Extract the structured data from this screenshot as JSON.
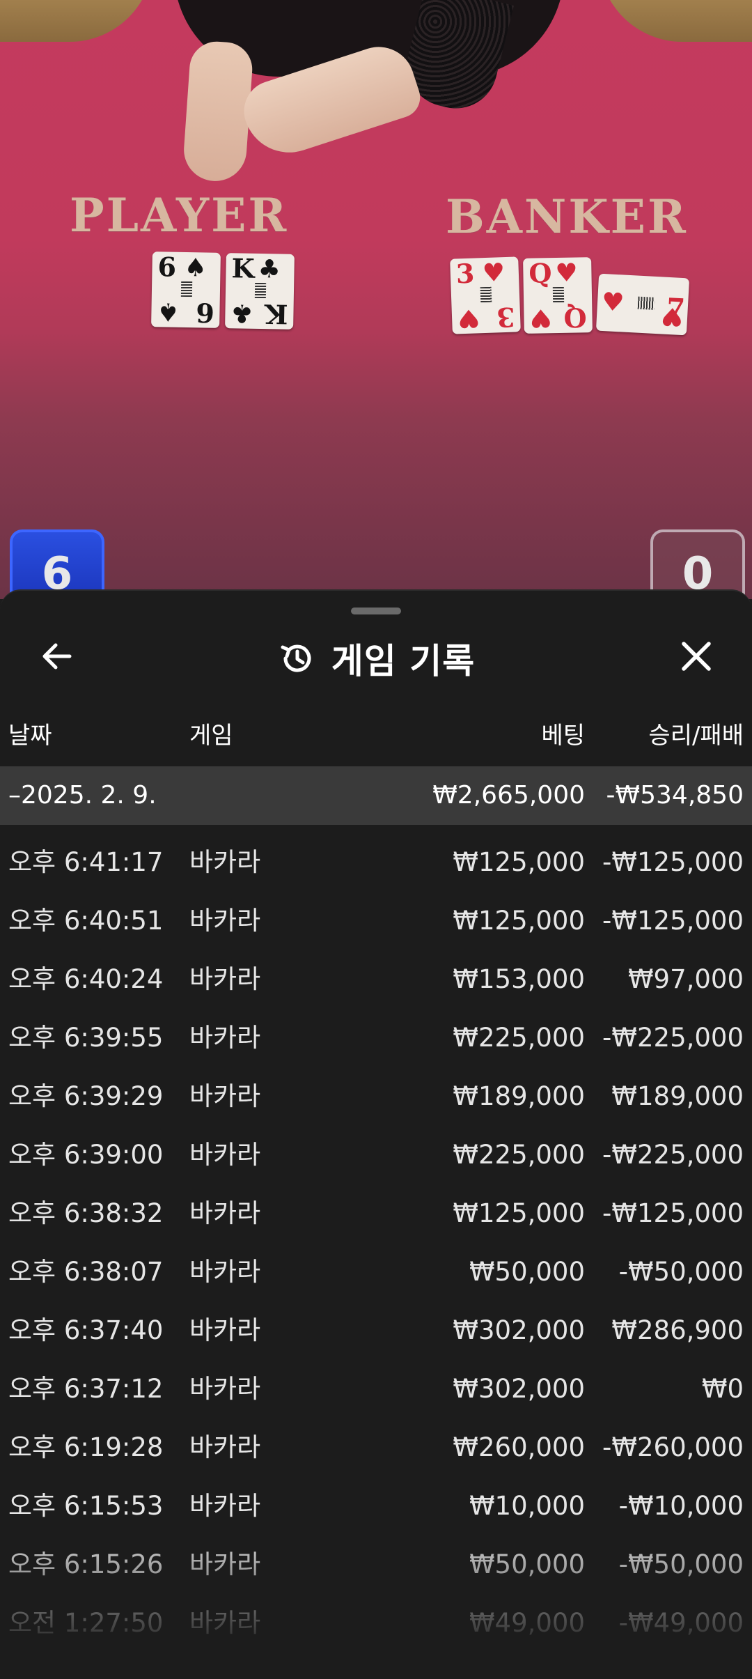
{
  "video": {
    "player_label": "PLAYER",
    "banker_label": "BANKER",
    "player_cards": [
      {
        "rank": "6",
        "suit": "♠",
        "color": "black"
      },
      {
        "rank": "K",
        "suit": "♣",
        "color": "black"
      }
    ],
    "banker_cards": [
      {
        "rank": "3",
        "suit": "♥",
        "color": "red"
      },
      {
        "rank": "Q",
        "suit": "♥",
        "color": "red"
      },
      {
        "rank": "7",
        "suit": "♥",
        "color": "red"
      }
    ],
    "player_score": "6",
    "banker_score": "0",
    "colors": {
      "felt": "#c43a5e",
      "player_badge": "#2a4fe0"
    }
  },
  "sheet": {
    "title": "게임 기록",
    "icons": {
      "back": "arrow-left-icon",
      "history": "history-icon",
      "close": "close-icon"
    },
    "columns": {
      "date": "날짜",
      "game": "게임",
      "bet": "베팅",
      "result": "승리/패배"
    },
    "group": {
      "date": "–2025. 2. 9.",
      "bet": "₩2,665,000",
      "result": "-₩534,850"
    },
    "rows": [
      {
        "time": "오후 6:41:17",
        "game": "바카라",
        "bet": "₩125,000",
        "result": "-₩125,000"
      },
      {
        "time": "오후 6:40:51",
        "game": "바카라",
        "bet": "₩125,000",
        "result": "-₩125,000"
      },
      {
        "time": "오후 6:40:24",
        "game": "바카라",
        "bet": "₩153,000",
        "result": "₩97,000"
      },
      {
        "time": "오후 6:39:55",
        "game": "바카라",
        "bet": "₩225,000",
        "result": "-₩225,000"
      },
      {
        "time": "오후 6:39:29",
        "game": "바카라",
        "bet": "₩189,000",
        "result": "₩189,000"
      },
      {
        "time": "오후 6:39:00",
        "game": "바카라",
        "bet": "₩225,000",
        "result": "-₩225,000"
      },
      {
        "time": "오후 6:38:32",
        "game": "바카라",
        "bet": "₩125,000",
        "result": "-₩125,000"
      },
      {
        "time": "오후 6:38:07",
        "game": "바카라",
        "bet": "₩50,000",
        "result": "-₩50,000"
      },
      {
        "time": "오후 6:37:40",
        "game": "바카라",
        "bet": "₩302,000",
        "result": "₩286,900"
      },
      {
        "time": "오후 6:37:12",
        "game": "바카라",
        "bet": "₩302,000",
        "result": "₩0"
      },
      {
        "time": "오후 6:19:28",
        "game": "바카라",
        "bet": "₩260,000",
        "result": "-₩260,000"
      },
      {
        "time": "오후 6:15:53",
        "game": "바카라",
        "bet": "₩10,000",
        "result": "-₩10,000"
      },
      {
        "time": "오후 6:15:26",
        "game": "바카라",
        "bet": "₩50,000",
        "result": "-₩50,000"
      },
      {
        "time": "오전 1:27:50",
        "game": "바카라",
        "bet": "₩49,000",
        "result": "-₩49,000"
      }
    ]
  }
}
